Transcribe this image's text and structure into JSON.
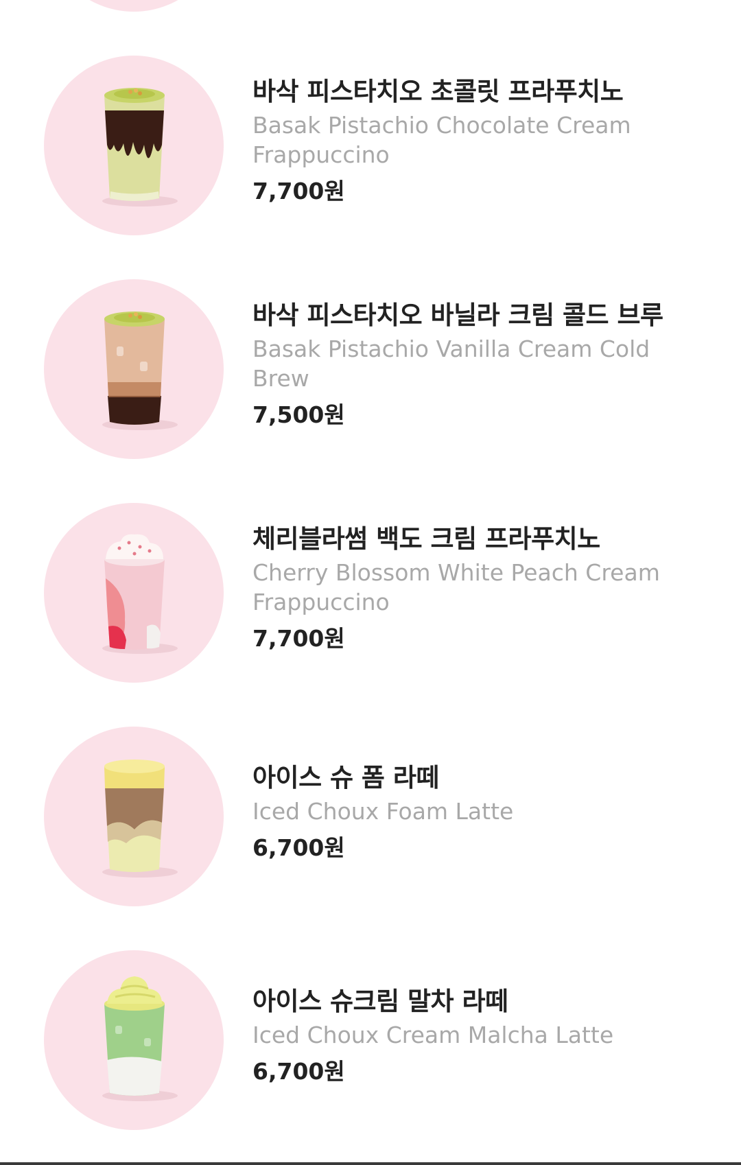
{
  "menu": {
    "items": [
      {
        "name_ko": "바삭 피스타치오 초콜릿 프라푸치노",
        "name_en": "Basak Pistachio Chocolate Cream Frappuccino",
        "price": "7,700원",
        "image_icon": "pistachio-chocolate-frappuccino-drink-icon"
      },
      {
        "name_ko": "바삭 피스타치오 바닐라 크림 콜드 브루",
        "name_en": "Basak Pistachio Vanilla Cream Cold Brew",
        "price": "7,500원",
        "image_icon": "pistachio-vanilla-cold-brew-drink-icon"
      },
      {
        "name_ko": "체리블라썸 백도 크림 프라푸치노",
        "name_en": "Cherry Blossom White Peach Cream Frappuccino",
        "price": "7,700원",
        "image_icon": "cherry-blossom-peach-frappuccino-drink-icon"
      },
      {
        "name_ko": "아이스 슈 폼 라떼",
        "name_en": "Iced Choux Foam Latte",
        "price": "6,700원",
        "image_icon": "iced-choux-foam-latte-drink-icon"
      },
      {
        "name_ko": "아이스 슈크림 말차 라떼",
        "name_en": "Iced Choux Cream Malcha Latte",
        "price": "6,700원",
        "image_icon": "iced-choux-cream-malcha-latte-drink-icon"
      }
    ]
  },
  "colors": {
    "thumb_background": "#fbe1e8",
    "title_text": "#222222",
    "subtitle_text": "#a8a8a8"
  }
}
